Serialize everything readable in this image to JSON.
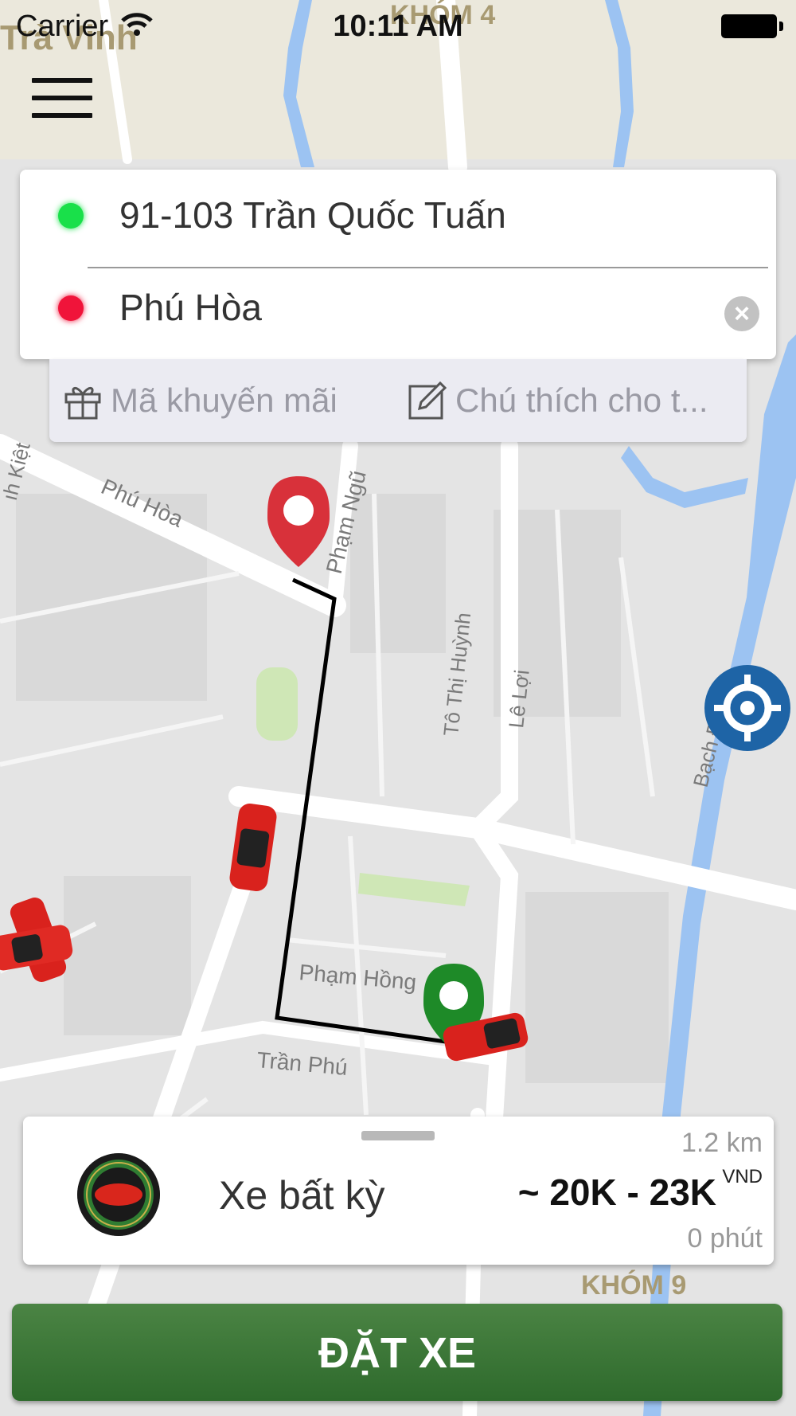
{
  "status_bar": {
    "carrier": "Carrier",
    "time": "10:11 AM"
  },
  "map": {
    "labels": {
      "tra_vinh": "Trà Vinh",
      "khom_4": "KHÓM 4",
      "khom_9": "KHÓM 9",
      "phu_hoa_street": "Phú Hòa",
      "pham_ngu": "Phạm Ngũ",
      "to_thi_huynh": "Tô Thị Huỳnh",
      "le_loi": "Lê Lợi",
      "bach_dang": "Bạch Đằng",
      "pham_hong": "Phạm Hồng",
      "tran_phu": "Trần Phú",
      "kiet": "ıh Kiệt"
    }
  },
  "route": {
    "pickup": "91-103 Trần Quốc Tuấn",
    "destination": "Phú Hòa",
    "clear_icon": "clear-icon"
  },
  "extras": {
    "promo_placeholder": "Mã khuyến mãi",
    "note_placeholder": "Chú thích cho t...",
    "promo_icon": "gift-icon",
    "note_icon": "edit-icon"
  },
  "trip": {
    "vehicle_type": "Xe bất kỳ",
    "distance": "1.2 km",
    "price": "~ 20K - 23K",
    "currency": "VND",
    "duration": "0 phút"
  },
  "actions": {
    "book": "ĐẶT XE"
  },
  "colors": {
    "primary_green": "#3b7a36",
    "pickup_dot": "#19e04a",
    "destination_dot": "#f0143a",
    "locate_blue": "#1e64a6",
    "river_blue": "#9cc3f2"
  }
}
